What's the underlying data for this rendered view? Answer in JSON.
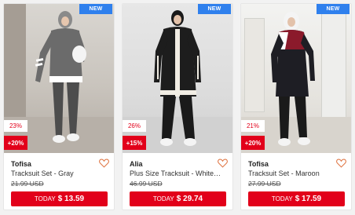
{
  "products": [
    {
      "new_label": "NEW",
      "discount": "23%",
      "extra": "+20%",
      "brand": "Tofisa",
      "name": "Tracksuit Set - Gray",
      "old_price": "21.99 USD",
      "today_label": "TODAY",
      "price": "$ 13.59",
      "colors": {
        "main": "#6b6b6b",
        "accent": "#ffffff",
        "pants": "#4d4d4d",
        "hijab": "#8a8a8a"
      }
    },
    {
      "new_label": "NEW",
      "discount": "26%",
      "extra": "+15%",
      "brand": "Alia",
      "name": "Plus Size Tracksuit - White Ecru...",
      "old_price": "46.99 USD",
      "today_label": "TODAY",
      "price": "$ 29.74",
      "colors": {
        "main": "#1d1d1d",
        "accent": "#f1ede4",
        "pants": "#1a1a1a",
        "hijab": "#000000"
      }
    },
    {
      "new_label": "NEW",
      "discount": "21%",
      "extra": "+20%",
      "brand": "Tofisa",
      "name": "Tracksuit Set - Maroon",
      "old_price": "27.99 USD",
      "today_label": "TODAY",
      "price": "$ 17.59",
      "colors": {
        "main": "#1e1e24",
        "accent": "#8b1a2b",
        "pants": "#1a1a1a",
        "hijab": "#f4f4f4"
      }
    }
  ],
  "theme": {
    "sale_red": "#e2001a",
    "new_blue": "#2f80ed",
    "heart": "#e07a4a"
  }
}
